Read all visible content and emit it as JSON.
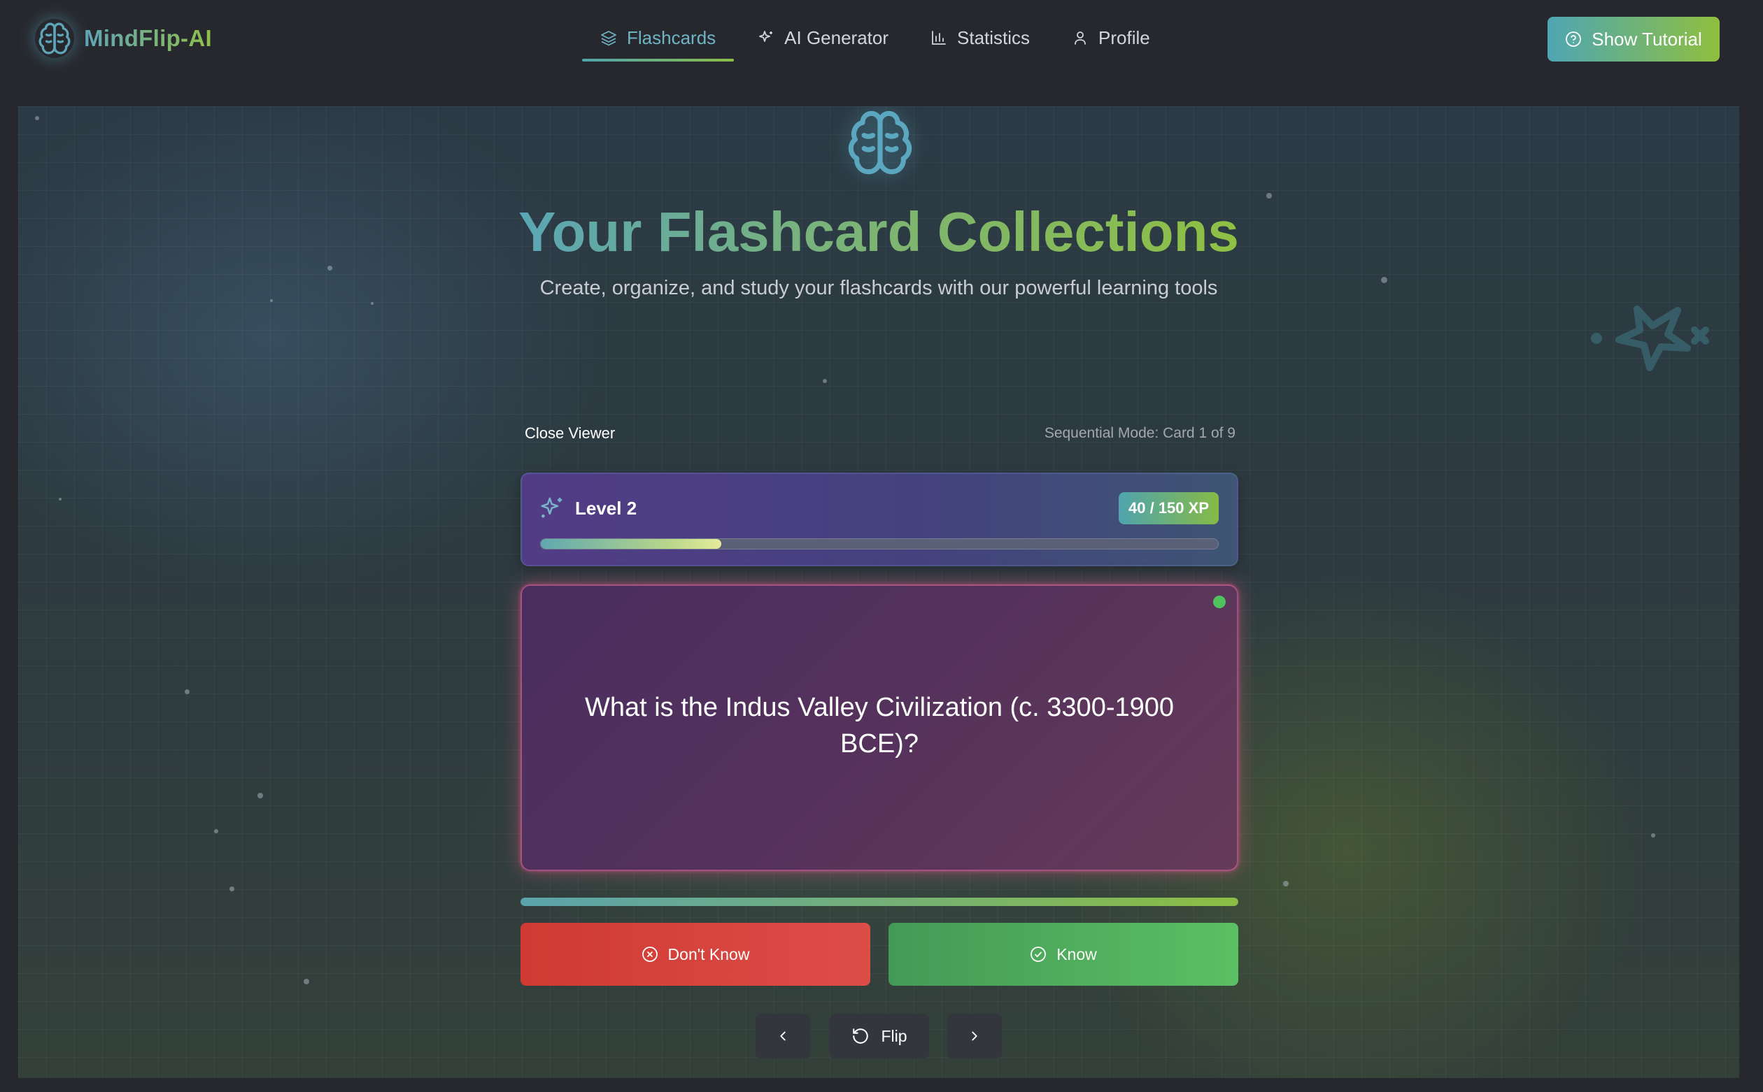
{
  "app": {
    "name": "MindFlip-AI"
  },
  "nav": {
    "items": [
      {
        "label": "Flashcards",
        "icon": "layers-icon",
        "active": true
      },
      {
        "label": "AI Generator",
        "icon": "sparkles-icon",
        "active": false
      },
      {
        "label": "Statistics",
        "icon": "bar-chart-icon",
        "active": false
      },
      {
        "label": "Profile",
        "icon": "user-icon",
        "active": false
      }
    ],
    "tutorial_button": "Show Tutorial"
  },
  "hero": {
    "title": "Your Flashcard Collections",
    "subtitle": "Create, organize, and study your flashcards with our powerful learning tools"
  },
  "viewer": {
    "close_label": "Close Viewer",
    "mode_text": "Sequential Mode: Card 1 of 9",
    "current_card": 1,
    "total_cards": 9
  },
  "level": {
    "label": "Level 2",
    "xp_text": "40 / 150 XP",
    "xp_current": 40,
    "xp_max": 150,
    "xp_fraction": 0.2667
  },
  "card": {
    "question": "What is the Indus Valley Civilization (c. 3300-1900 BCE)?",
    "status_color": "#4fc25f",
    "session_progress_fraction": 1.0
  },
  "actions": {
    "dont_know": "Don't Know",
    "know": "Know",
    "flip": "Flip"
  },
  "colors": {
    "brand_gradient_start": "#4ea6b3",
    "brand_gradient_end": "#8fbf3f",
    "dont_know": "#d63f3a",
    "know": "#4fae5c",
    "card_border_glow": "#eb5a8c"
  }
}
